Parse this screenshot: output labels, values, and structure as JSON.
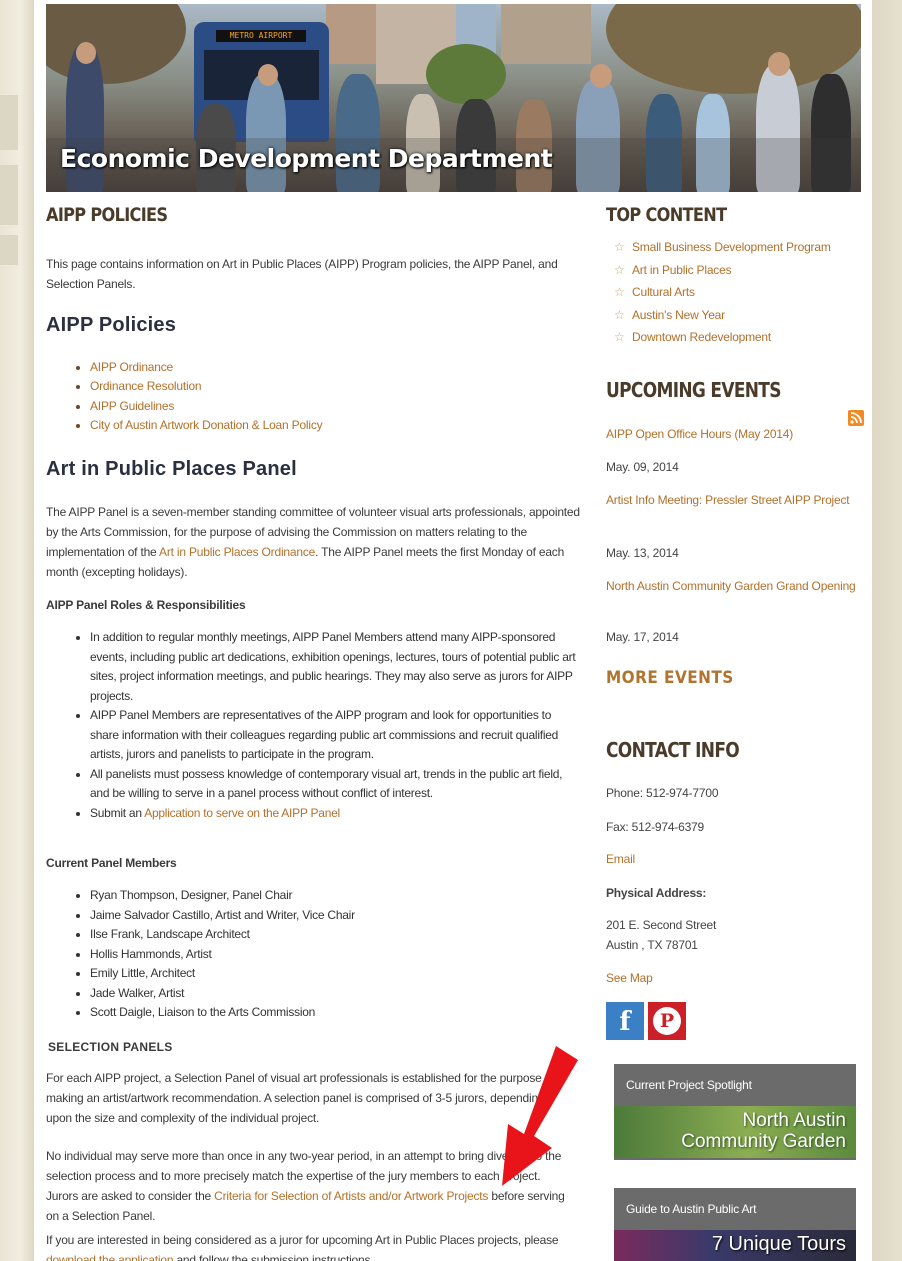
{
  "banner": {
    "title": "Economic Development Department",
    "bus_sign": "METRO AIRPORT"
  },
  "main": {
    "heading": "AIPP POLICIES",
    "intro": "This page contains information on Art in Public Places (AIPP) Program policies, the AIPP Panel, and Selection Panels.",
    "policies_heading": "AIPP Policies",
    "policy_links": [
      "AIPP Ordinance",
      "Ordinance Resolution",
      "AIPP Guidelines",
      "City of Austin Artwork Donation & Loan Policy"
    ],
    "panel_heading": "Art in Public Places Panel",
    "panel_p1_a": "The AIPP Panel is a seven-member standing committee of volunteer visual arts professionals, appointed by the Arts Commission, for the purpose of advising the Commission on matters relating to the implementation of the",
    "panel_p1_link": "Art in Public Places Ordinance",
    "panel_p1_b": ". The AIPP Panel meets the first Monday of each month (excepting holidays).",
    "roles_heading": "AIPP Panel Roles & Responsibilities",
    "roles": [
      "In addition to regular monthly meetings, AIPP Panel Members attend many AIPP-sponsored events, including public art dedications, exhibition openings, lectures, tours of potential public art sites, project information meetings, and public hearings. They may also serve as jurors for AIPP projects.",
      "AIPP Panel Members are representatives of the AIPP program and look for opportunities to share information with their colleagues regarding public art commissions and recruit qualified artists, jurors and panelists to participate in the program.",
      "All panelists must possess knowledge of contemporary visual art, trends in the public art field, and be willing to serve in a panel process without conflict of interest."
    ],
    "submit_prefix": "Submit an",
    "submit_link": "Application to serve on the AIPP Panel",
    "members_heading": "Current Panel Members",
    "members": [
      "Ryan Thompson, Designer, Panel Chair",
      "Jaime Salvador Castillo, Artist and Writer, Vice Chair",
      "Ilse Frank, Landscape Architect",
      "Hollis Hammonds, Artist",
      "Emily Little, Architect",
      "Jade Walker, Artist",
      "Scott Daigle, Liaison to the Arts Commission"
    ],
    "selection_heading": "SELECTION PANELS",
    "sel_p1": "For each AIPP project, a Selection Panel of visual art professionals is established for the purpose of making an artist/artwork recommendation. A selection panel is comprised of 3-5 jurors, depending upon the size and complexity of the individual project.",
    "sel_p2_a": "No individual may serve more than once in any two-year period, in an attempt to bring diversity to the selection process and to more precisely match the expertise of the jury members to each project. Jurors are asked to consider the",
    "sel_p2_link": "Criteria for Selection of Artists and/or Artwork Projects",
    "sel_p2_b": "before serving on a Selection Panel.",
    "sel_p3_a": "If you are interested in being considered as a juror for upcoming Art in Public Places projects, please",
    "sel_p3_link": "download the application",
    "sel_p3_b": "and follow the submission instructions."
  },
  "sidebar": {
    "top_heading": "TOP CONTENT",
    "top_items": [
      "Small Business Development Program",
      "Art in Public Places",
      "Cultural Arts",
      "Austin's New Year",
      "Downtown Redevelopment"
    ],
    "events_heading": "UPCOMING EVENTS",
    "events": [
      {
        "title": "AIPP Open Office Hours (May 2014)",
        "date": "May. 09, 2014"
      },
      {
        "title": "Artist Info Meeting: Pressler Street AIPP Project",
        "date": "May. 13, 2014"
      },
      {
        "title": "North Austin Community Garden Grand Opening",
        "date": "May. 17, 2014"
      }
    ],
    "more_events": "MORE EVENTS",
    "contact_heading": "CONTACT INFO",
    "phone": "Phone: 512-974-7700",
    "fax": "Fax: 512-974-6379",
    "email": "Email",
    "address_label": "Physical Address:",
    "address_line1": "201 E. Second Street",
    "address_line2": "Austin , TX 78701",
    "see_map": "See Map",
    "facebook": "f",
    "pinterest": "P",
    "promo1_header": "Current Project Spotlight",
    "promo1_cap1": "North Austin",
    "promo1_cap2": "Community Garden",
    "promo2_header": "Guide to Austin Public Art",
    "promo2_cap": "7 Unique Tours"
  },
  "colors": {
    "link": "#b3702a",
    "heading": "#4a3b2a",
    "arrow": "#e8141a",
    "facebook": "#3b7fc4",
    "pinterest": "#cb2027"
  }
}
